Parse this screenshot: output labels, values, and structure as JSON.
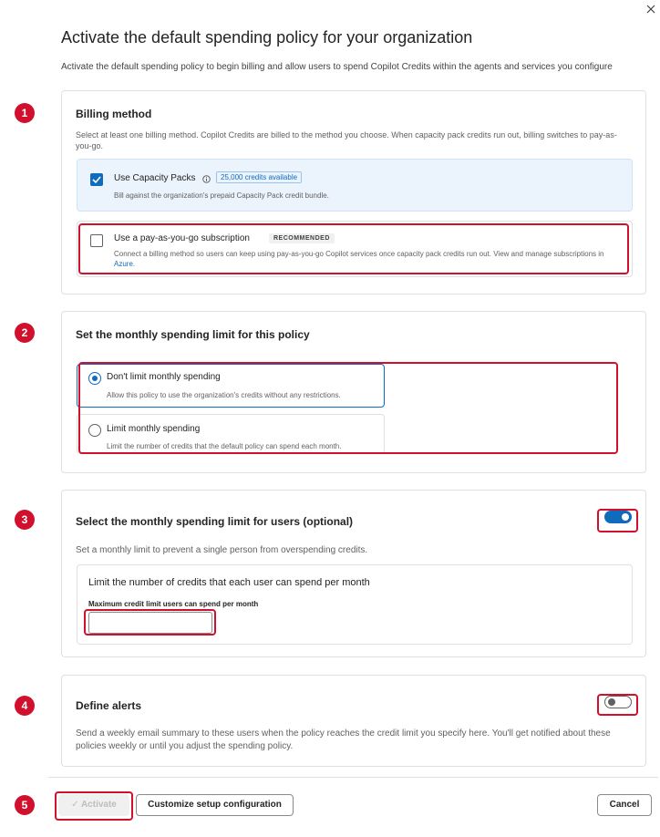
{
  "dialog": {
    "title": "Activate the default spending policy for your organization",
    "subtitle": "Activate the default spending policy to begin billing and allow users to spend Copilot Credits within the agents and services you configure"
  },
  "steps": [
    "1",
    "2",
    "3",
    "4",
    "5"
  ],
  "billing": {
    "title": "Billing method",
    "description": "Select at least one billing method. Copilot Credits are billed to the method you choose. When capacity pack credits run out, billing switches to pay-as-you-go.",
    "capacity": {
      "label": "Use Capacity Packs",
      "badge": "25,000 credits available",
      "description": "Bill against the organization's prepaid Capacity Pack credit bundle.",
      "checked": true
    },
    "payg": {
      "label": "Use a pay-as-you-go subscription",
      "badge": "RECOMMENDED",
      "description": "Connect a billing method so users can keep using pay-as-you-go Copilot services once capacity pack credits run out. View and manage subscriptions in",
      "link": "Azure",
      "period": ".",
      "checked": false
    }
  },
  "monthly_limit": {
    "title": "Set the monthly spending limit for this policy",
    "options": [
      {
        "label": "Don't limit monthly spending",
        "description": "Allow this policy to use the organization's credits without any restrictions.",
        "selected": true
      },
      {
        "label": "Limit monthly spending",
        "description": "Limit the number of credits that the default policy can spend each month.",
        "selected": false
      }
    ]
  },
  "user_limit": {
    "title": "Select the monthly spending limit for users (optional)",
    "description": "Set a monthly limit to prevent a single person from overspending credits.",
    "toggle_on": true,
    "card_title": "Limit the number of credits that each user can spend per month",
    "field_label": "Maximum credit limit users can spend per month",
    "field_value": ""
  },
  "alerts": {
    "title": "Define alerts",
    "description": "Send a weekly email summary to these users when the policy reaches the credit limit you specify here. You'll get notified about these policies weekly or until you adjust the spending policy.",
    "toggle_on": false
  },
  "footer": {
    "activate": "Activate",
    "customize": "Customize setup configuration",
    "cancel": "Cancel"
  },
  "colors": {
    "accent": "#0f6cbd",
    "annotation": "#d0102c"
  }
}
